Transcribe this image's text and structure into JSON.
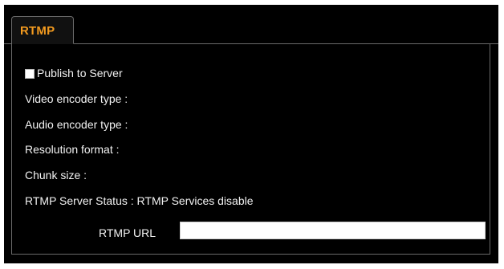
{
  "tabs": [
    {
      "label": "RTMP",
      "active": true
    }
  ],
  "publish": {
    "label": "Publish to Server",
    "checked": false
  },
  "fields": [
    {
      "label": "Video encoder type :"
    },
    {
      "label": "Audio encoder type :"
    },
    {
      "label": "Resolution format :"
    },
    {
      "label": "Chunk size :"
    }
  ],
  "server_status": {
    "text": "RTMP Server Status : RTMP Services disable"
  },
  "rtmp_url": {
    "label": "RTMP URL",
    "value": ""
  },
  "colors": {
    "tab_text": "#f29a1f",
    "background": "#000000",
    "text": "#f2f2f2",
    "border": "#6a6a6a"
  }
}
